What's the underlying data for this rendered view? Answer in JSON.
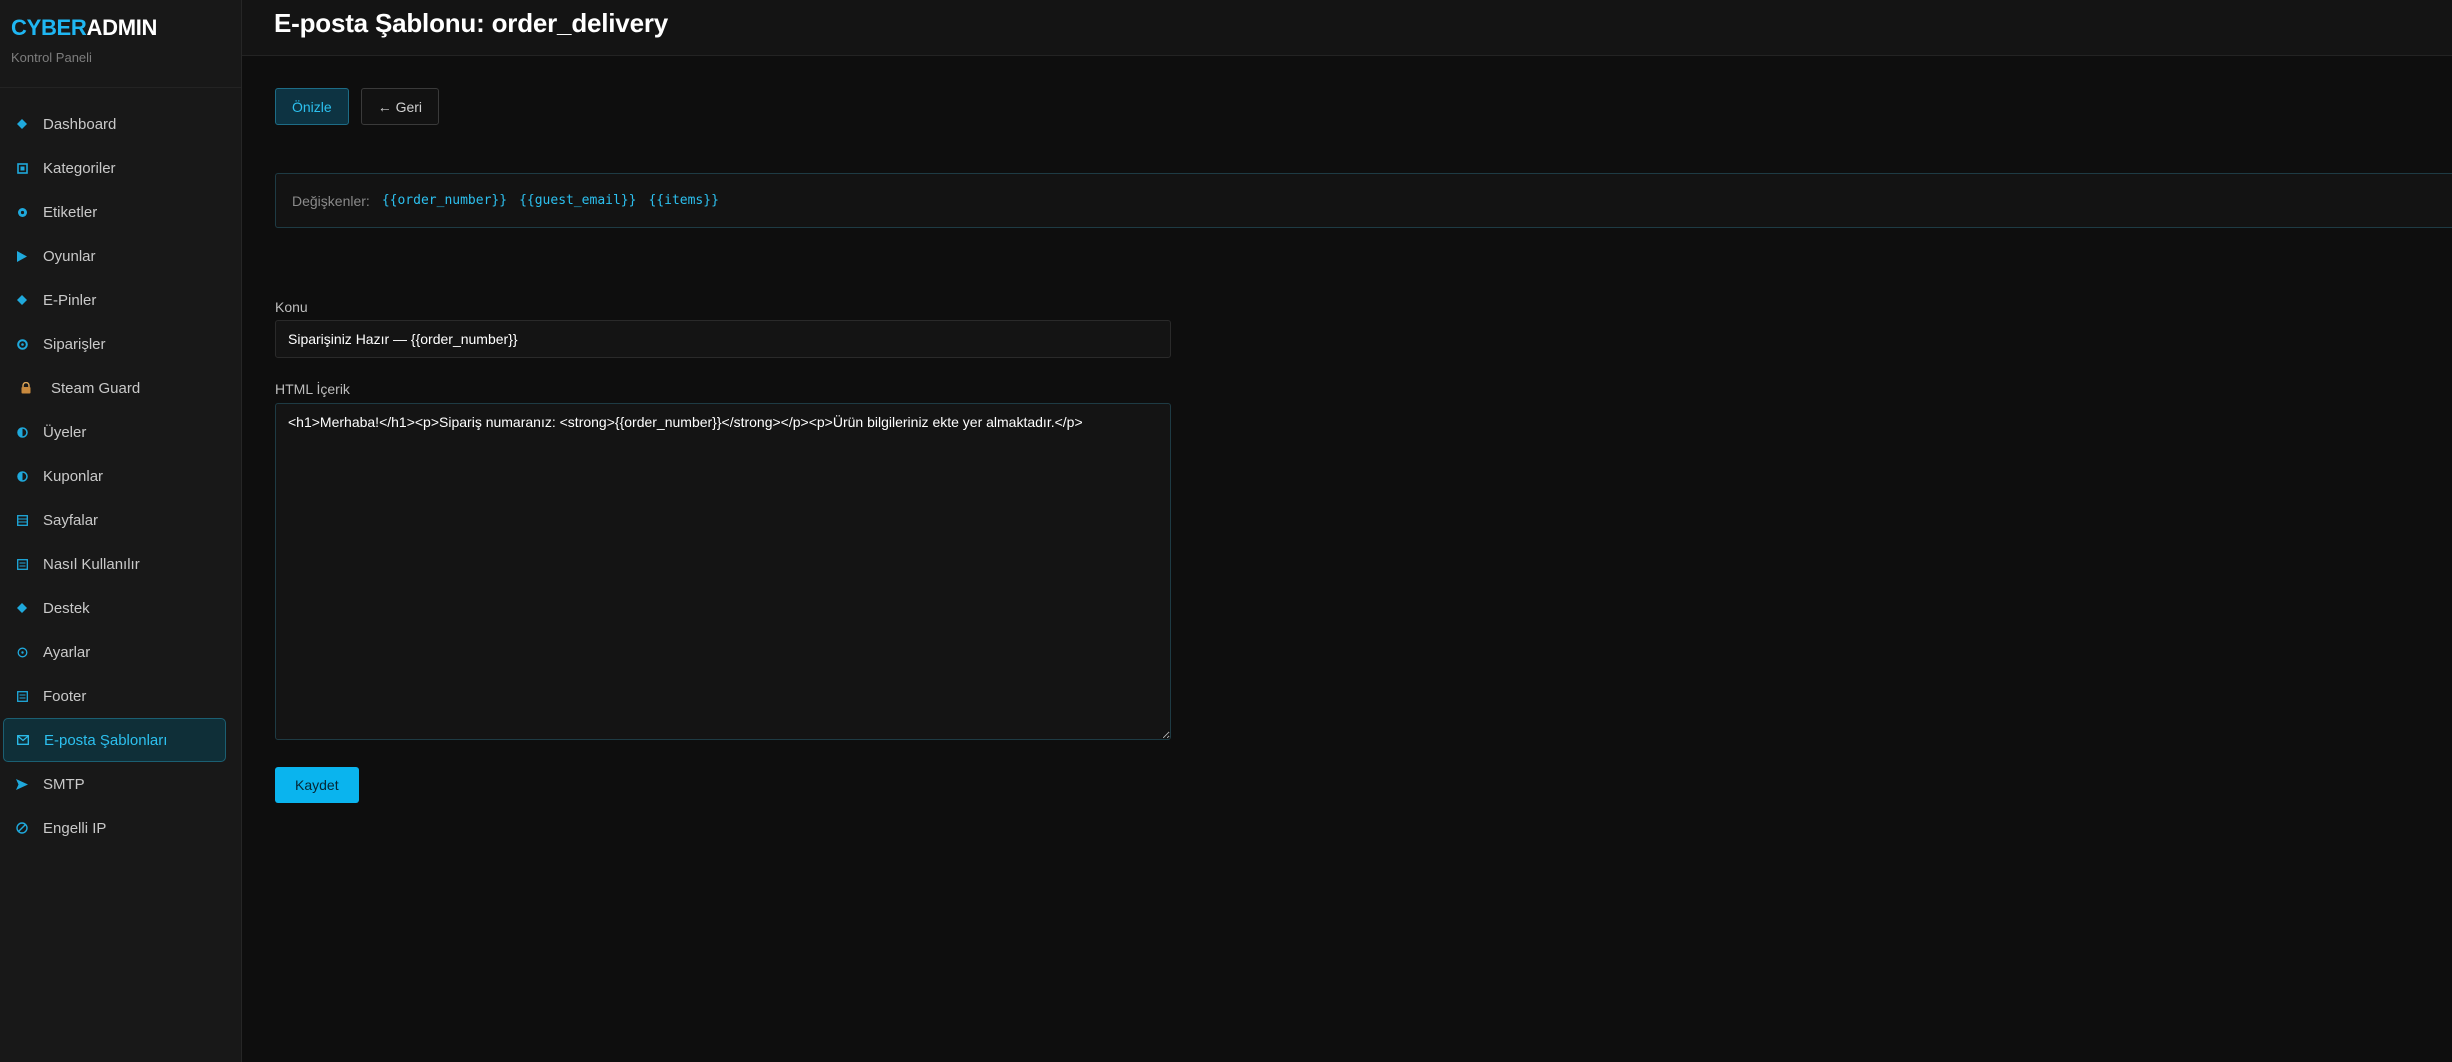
{
  "brand": {
    "logo_part1": "CYBER",
    "logo_part2": "ADMIN",
    "subtitle": "Kontrol Paneli",
    "accent_color": "#1fb6f2"
  },
  "sidebar": {
    "items": [
      {
        "label": "Dashboard",
        "icon": "diamond-icon"
      },
      {
        "label": "Kategoriler",
        "icon": "square-icon"
      },
      {
        "label": "Etiketler",
        "icon": "asterisk-icon"
      },
      {
        "label": "Oyunlar",
        "icon": "play-icon"
      },
      {
        "label": "E-Pinler",
        "icon": "diamond-icon"
      },
      {
        "label": "Siparişler",
        "icon": "gear-icon"
      },
      {
        "label": "Steam Guard",
        "icon": "lock-icon"
      },
      {
        "label": "Üyeler",
        "icon": "half-circle-icon"
      },
      {
        "label": "Kuponlar",
        "icon": "half-circle-icon"
      },
      {
        "label": "Sayfalar",
        "icon": "grid-icon"
      },
      {
        "label": "Nasıl Kullanılır",
        "icon": "list-icon"
      },
      {
        "label": "Destek",
        "icon": "diamond-icon"
      },
      {
        "label": "Ayarlar",
        "icon": "settings-icon"
      },
      {
        "label": "Footer",
        "icon": "list-icon"
      },
      {
        "label": "E-posta Şablonları",
        "icon": "mail-icon",
        "active": true
      },
      {
        "label": "SMTP",
        "icon": "send-icon"
      },
      {
        "label": "Engelli IP",
        "icon": "block-icon"
      }
    ]
  },
  "header": {
    "title": "E-posta Şablonu: order_delivery"
  },
  "actions": {
    "preview_label": "Önizle",
    "back_label": "← Geri"
  },
  "variables": {
    "label": "Değişkenler:",
    "items": [
      "{{order_number}}",
      "{{guest_email}}",
      "{{items}}"
    ]
  },
  "form": {
    "subject_label": "Konu",
    "subject_value": "Siparişiniz Hazır — {{order_number}}",
    "content_label": "HTML İçerik",
    "content_value": "<h1>Merhaba!</h1><p>Sipariş numaranız: <strong>{{order_number}}</strong></p><p>Ürün bilgileriniz ekte yer almaktadır.</p>",
    "save_label": "Kaydet"
  }
}
